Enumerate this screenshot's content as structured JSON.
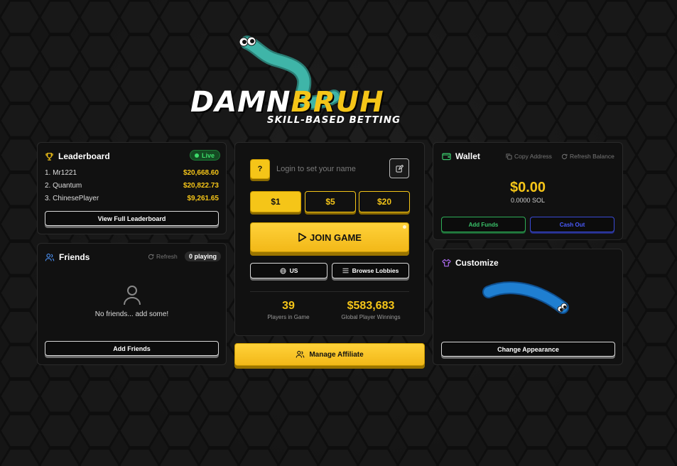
{
  "brand": {
    "title_part1": "DAMN",
    "title_part2": "BRUH",
    "subtitle": "SKILL-BASED BETTING"
  },
  "colors": {
    "accent": "#f5c518",
    "live_green": "#3ddc6a",
    "snake_teal": "#3fb5a8",
    "snake_blue": "#1f7fd1",
    "cashout_blue": "#4a5bff"
  },
  "leaderboard": {
    "title": "Leaderboard",
    "icon": "trophy-icon",
    "live_label": "Live",
    "entries": [
      {
        "name": "1. Mr1221",
        "amount": "$20,668.60"
      },
      {
        "name": "2. Quantum",
        "amount": "$20,822.73"
      },
      {
        "name": "3. ChinesePlayer",
        "amount": "$9,261.65"
      }
    ],
    "view_all_label": "View Full Leaderboard"
  },
  "friends": {
    "title": "Friends",
    "icon": "users-icon",
    "refresh_label": "Refresh",
    "playing_count": "0 playing",
    "empty_text": "No friends... add some!",
    "add_label": "Add Friends"
  },
  "play": {
    "help_label": "?",
    "name_placeholder": "Login to set your name",
    "bets": [
      "$1",
      "$5",
      "$20"
    ],
    "selected_bet": "$1",
    "join_label": "JOIN GAME",
    "region_label": "US",
    "browse_label": "Browse Lobbies",
    "stats": [
      {
        "value": "39",
        "label": "Players in Game"
      },
      {
        "value": "$583,683",
        "label": "Global Player Winnings"
      }
    ],
    "affiliate_label": "Manage Affiliate"
  },
  "wallet": {
    "title": "Wallet",
    "icon": "wallet-icon",
    "copy_label": "Copy Address",
    "refresh_label": "Refresh Balance",
    "balance_usd": "$0.00",
    "balance_sol": "0.0000 SOL",
    "add_funds_label": "Add Funds",
    "cash_out_label": "Cash Out"
  },
  "customize": {
    "title": "Customize",
    "icon": "shirt-icon",
    "change_label": "Change Appearance"
  }
}
